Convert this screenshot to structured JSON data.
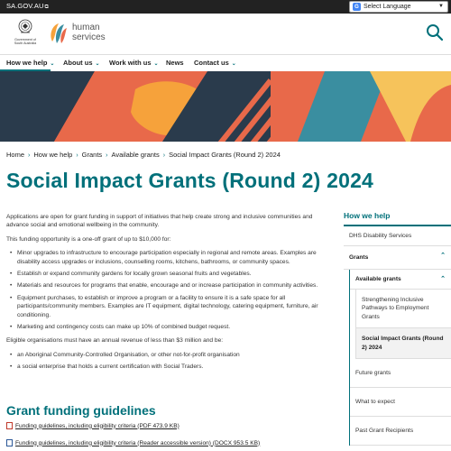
{
  "topbar": {
    "gov_link": "SA.GOV.AU",
    "language_label": "Select Language"
  },
  "header": {
    "crest_text": "Government of South Australia",
    "brand_line1": "human",
    "brand_line2": "services"
  },
  "nav": {
    "items": [
      {
        "label": "How we help",
        "has_menu": true,
        "active": true
      },
      {
        "label": "About us",
        "has_menu": true
      },
      {
        "label": "Work with us",
        "has_menu": true
      },
      {
        "label": "News",
        "has_menu": false
      },
      {
        "label": "Contact us",
        "has_menu": true
      }
    ]
  },
  "breadcrumb": [
    "Home",
    "How we help",
    "Grants",
    "Available grants",
    "Social Impact Grants (Round 2) 2024"
  ],
  "page": {
    "title": "Social Impact Grants (Round 2) 2024",
    "intro": "Applications are open for grant funding in support of initiatives that help create strong and inclusive communities and advance social and emotional wellbeing in the community.",
    "funding_note": "This funding opportunity is a one-off grant of up to $10,000 for:",
    "funding_items": [
      "Minor upgrades to infrastructure to encourage participation especially in regional and remote areas. Examples are disability access upgrades or inclusions, counselling rooms, kitchens, bathrooms, or community spaces.",
      "Establish or expand community gardens for locally grown seasonal fruits and vegetables.",
      "Materials and resources for programs that enable, encourage and or increase participation in community activities.",
      "Equipment purchases, to establish or improve a program or a facility to ensure it is a safe space for all participants/community members. Examples are IT equipment, digital technology, catering equipment, furniture, air conditioning.",
      "Marketing and contingency costs can make up 10% of combined budget request."
    ],
    "eligible_intro": "Eligible organisations must have an annual revenue of less than $3 million and be:",
    "eligible_items": [
      "an Aboriginal Community-Controlled Organisation, or other not-for-profit organisation",
      "a social enterprise that holds a current certification with Social Traders."
    ],
    "guidelines_heading": "Grant funding guidelines",
    "downloads": [
      {
        "label": "Funding guidelines, including eligibility criteria (PDF 473.9 KB)",
        "type": "pdf"
      },
      {
        "label": "Funding guidelines, including eligibility criteria (Reader accessible version) (DOCX 953.5 KB)",
        "type": "docx"
      }
    ]
  },
  "sidebar": {
    "title": "How we help",
    "top": "DHS Disability Services",
    "grants": "Grants",
    "available": "Available grants",
    "sub_items": [
      "Strengthening Inclusive Pathways to Employment Grants",
      "Social Impact Grants (Round 2) 2024"
    ],
    "after": [
      "Future grants",
      "What to expect",
      "Past Grant Recipients"
    ]
  },
  "colors": {
    "accent": "#00707a",
    "banner_orange": "#e8694a",
    "banner_navy": "#2a3b4c",
    "banner_yellow": "#f6c35b",
    "banner_teal": "#3a8ea0"
  }
}
